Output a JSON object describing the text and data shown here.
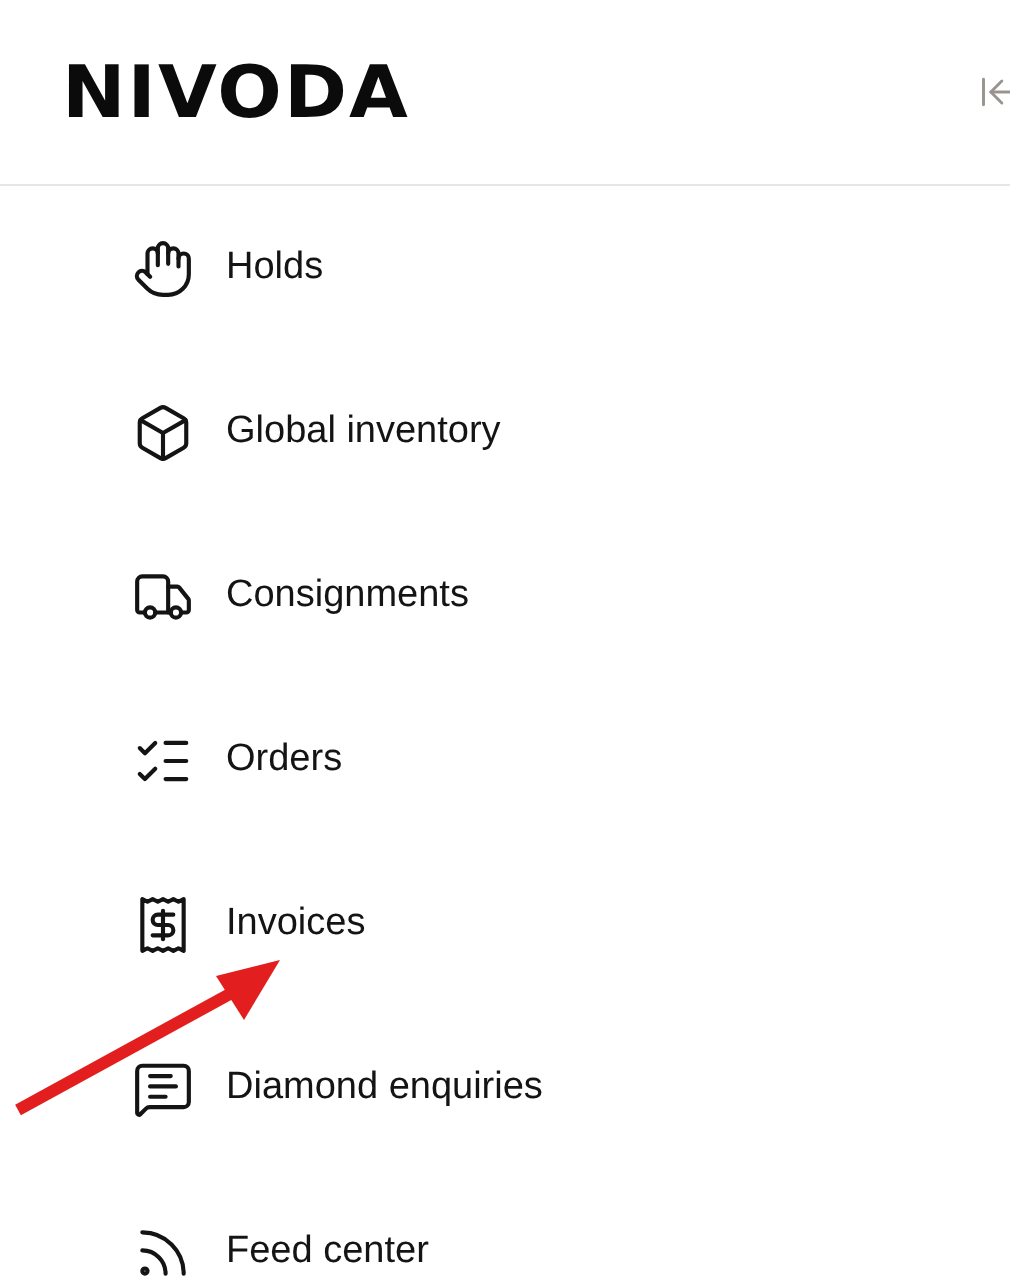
{
  "header": {
    "logo": "NIVODA",
    "collapse_button": {
      "kind": "collapse"
    }
  },
  "sidebar": {
    "items": [
      {
        "label": "Holds"
      },
      {
        "label": "Global inventory"
      },
      {
        "label": "Consignments"
      },
      {
        "label": "Orders"
      },
      {
        "label": "Invoices"
      },
      {
        "label": "Diamond enquiries"
      },
      {
        "label": "Feed center"
      }
    ]
  },
  "annotations": [
    {
      "kind": "arrow"
    }
  ]
}
